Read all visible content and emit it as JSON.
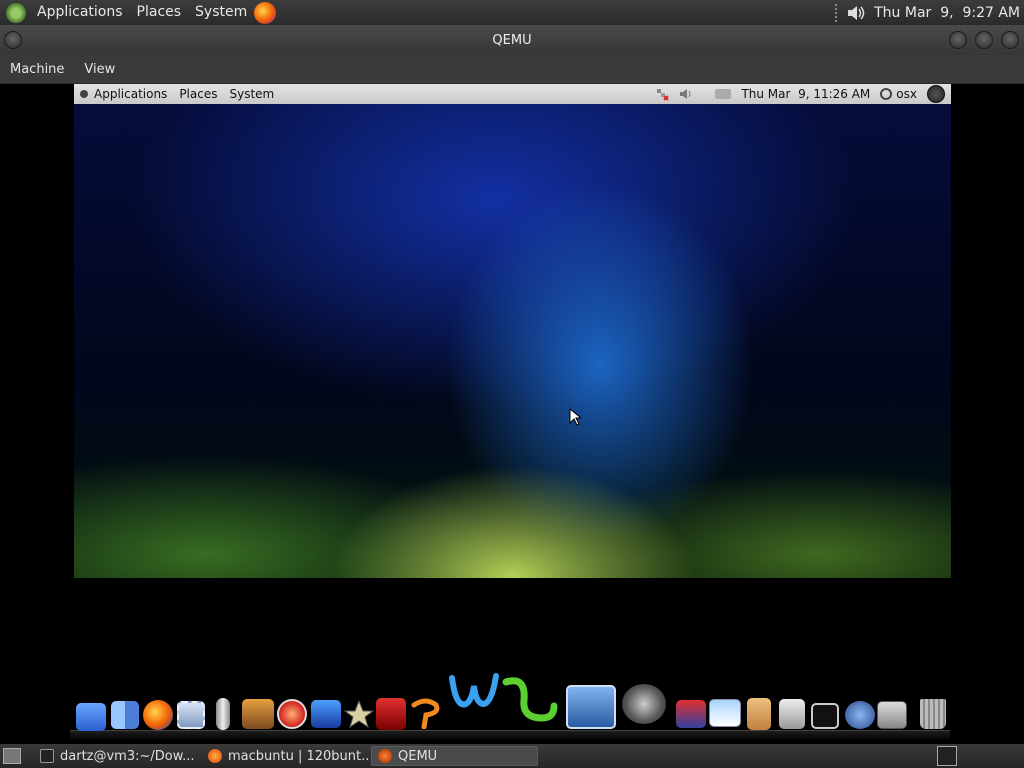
{
  "host_panel": {
    "menus": [
      "Applications",
      "Places",
      "System"
    ],
    "clock": "Thu Mar  9,  9:27 AM"
  },
  "window": {
    "title": "QEMU",
    "menus": [
      "Machine",
      "View"
    ]
  },
  "guest_panel": {
    "menus": [
      "Applications",
      "Places",
      "System"
    ],
    "clock": "Thu Mar  9, 11:26 AM",
    "user": "osx"
  },
  "taskbar": {
    "items": [
      {
        "label": "dartz@vm3:~/Dow..."
      },
      {
        "label": "macbuntu | 120bunt..."
      },
      {
        "label": "QEMU"
      }
    ]
  },
  "colors": {
    "panel_dark": "#2b2b2b",
    "guest_panel": "#d6d6d6",
    "wallpaper_blue": "#1e5fd2",
    "wallpaper_green": "#b6d860"
  }
}
